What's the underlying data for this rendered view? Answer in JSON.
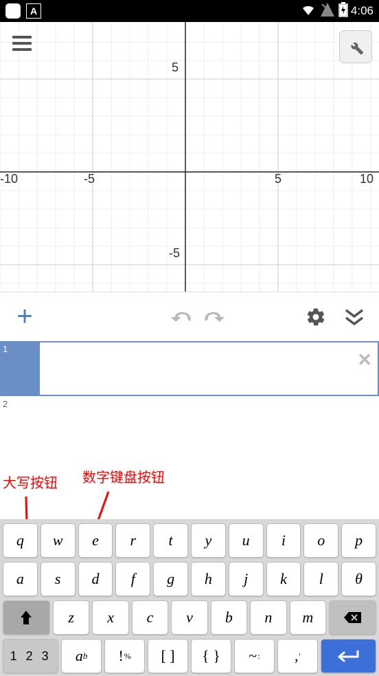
{
  "status_bar": {
    "time": "4:06",
    "wifi_icon": "wifi",
    "battery_icon": "battery-charging",
    "signal_icon": "no-signal"
  },
  "chart_data": {
    "type": "line",
    "series": [],
    "xlim": [
      -10,
      10
    ],
    "ylim": [
      -5,
      5
    ],
    "x_ticks": [
      -10,
      -5,
      5,
      10
    ],
    "y_ticks": [
      -5,
      5
    ],
    "grid": true,
    "title": "",
    "xlabel": "",
    "ylabel": ""
  },
  "toolbar": {
    "add_label": "+",
    "undo_label": "↶",
    "redo_label": "↷",
    "settings_label": "⚙",
    "collapse_label": "⌄"
  },
  "expressions": [
    {
      "index": "1",
      "value": "",
      "active": true
    },
    {
      "index": "2",
      "value": "",
      "active": false
    }
  ],
  "annotations": {
    "caps_label": "大写按钮",
    "numpad_label": "数字键盘按钮"
  },
  "keyboard": {
    "row1": [
      "q",
      "w",
      "e",
      "r",
      "t",
      "y",
      "u",
      "i",
      "o",
      "p"
    ],
    "row2": [
      "a",
      "s",
      "d",
      "f",
      "g",
      "h",
      "j",
      "k",
      "l",
      "θ"
    ],
    "row3_shift": "⬆",
    "row3": [
      "z",
      "x",
      "c",
      "v",
      "b",
      "n",
      "m"
    ],
    "row3_backspace": "⌫",
    "row4_num": "1 2 3",
    "row4_sub": "a",
    "row4_sub_b": "b",
    "row4_excl": "!",
    "row4_pct": "%",
    "row4_brackets": "[  ]",
    "row4_braces": "{  }",
    "row4_tilde": "~",
    "row4_colon": ":",
    "row4_comma": ",",
    "row4_apos": "'",
    "row4_enter": "⏎"
  }
}
